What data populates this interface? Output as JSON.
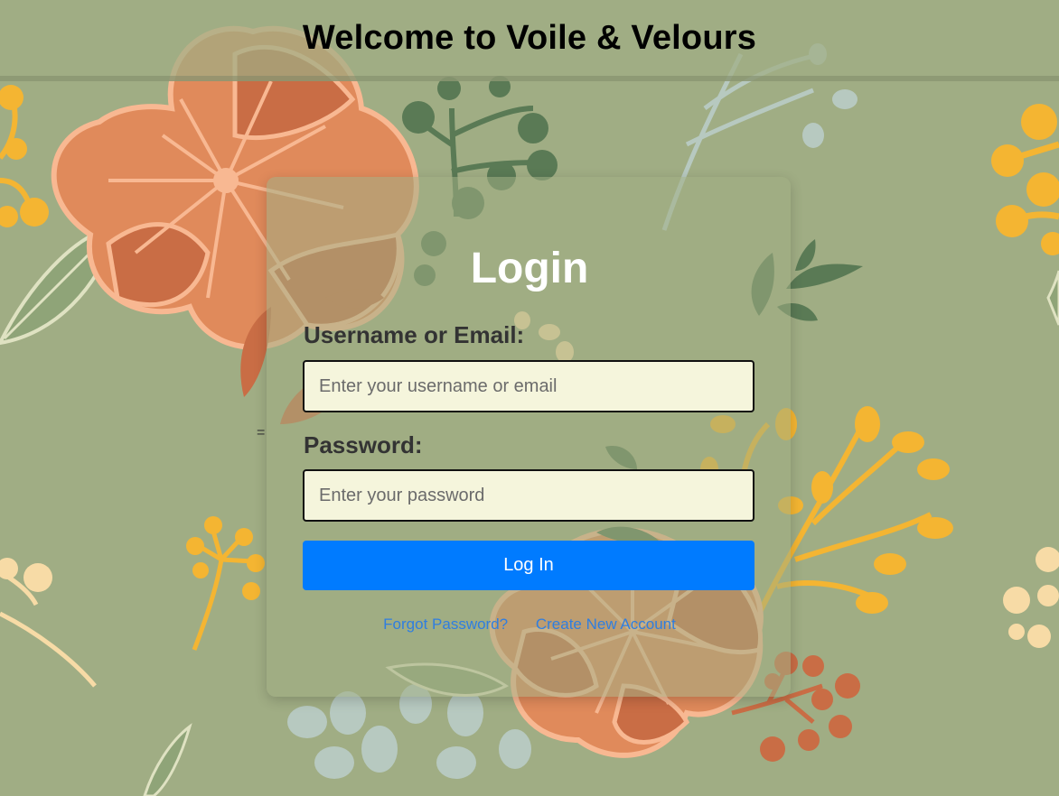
{
  "header": {
    "title": "Welcome to Voile & Velours"
  },
  "login": {
    "title": "Login",
    "username_label": "Username or Email:",
    "username_placeholder": "Enter your username or email",
    "username_value": "",
    "password_label": "Password:",
    "password_placeholder": "Enter your password",
    "password_value": "",
    "submit_label": "Log In",
    "forgot_link": "Forgot Password?",
    "create_link": "Create New Account",
    "stray_text": "="
  },
  "colors": {
    "background": "#a0ad84",
    "button": "#007bff",
    "input_bg": "#f5f5dc",
    "link": "#2f7ee0",
    "flower_orange": "#e08a5b",
    "flower_dark": "#c96d45",
    "leaf_dark": "#5a7a55",
    "berry_yellow": "#f4b532"
  }
}
